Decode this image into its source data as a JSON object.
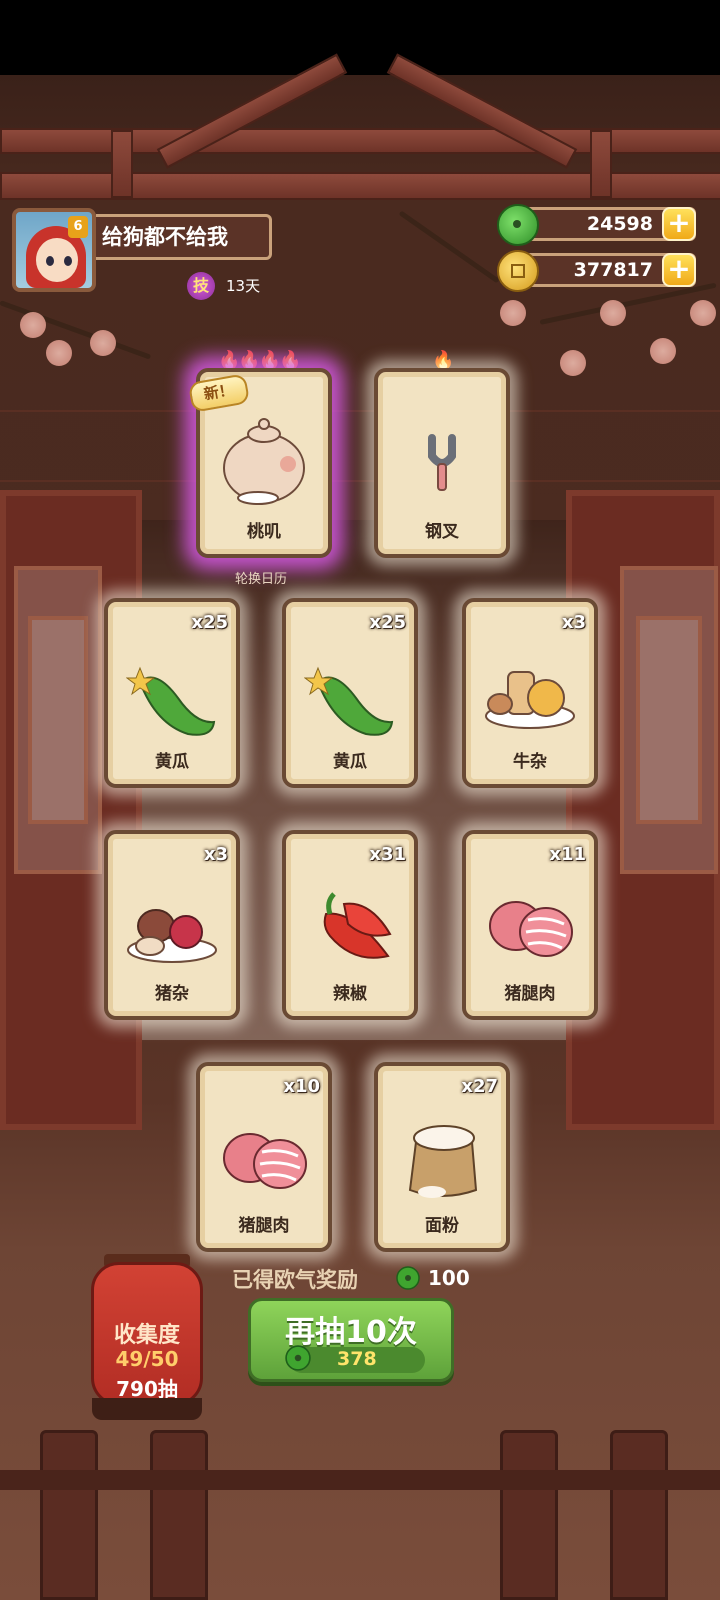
{
  "player": {
    "name": "给狗都不给我",
    "avatar_badge": "6",
    "skill_icon_char": "技",
    "skill_days": "13天"
  },
  "currency": {
    "jade": "24598",
    "coins": "377817",
    "plus": "+"
  },
  "featured": [
    {
      "name": "桃叽",
      "flames": "🔥🔥🔥🔥",
      "new_tag": "新！",
      "rare": true
    },
    {
      "name": "钢叉",
      "flames": "🔥",
      "rare": false
    }
  ],
  "calendar_label": "轮换日历",
  "items": [
    {
      "name": "黄瓜",
      "qty": "x25",
      "art": "cucumber"
    },
    {
      "name": "黄瓜",
      "qty": "x25",
      "art": "cucumber"
    },
    {
      "name": "牛杂",
      "qty": "x3",
      "art": "offal-plate"
    },
    {
      "name": "猪杂",
      "qty": "x3",
      "art": "pork-offal-plate"
    },
    {
      "name": "辣椒",
      "qty": "x31",
      "art": "chili"
    },
    {
      "name": "猪腿肉",
      "qty": "x11",
      "art": "pork-leg"
    },
    {
      "name": "猪腿肉",
      "qty": "x10",
      "art": "pork-leg"
    },
    {
      "name": "面粉",
      "qty": "x27",
      "art": "flour-sack"
    }
  ],
  "reward": {
    "text": "已得欧气奖励",
    "amount": "100"
  },
  "collection": {
    "label": "收集度",
    "progress": "49/50",
    "draws": "790抽"
  },
  "draw_button": {
    "label": "再抽10次",
    "cost": "378"
  },
  "colors": {
    "jade": "#3fa52f",
    "coin": "#e0a21c",
    "rare_glow": "#d75ae6",
    "button_green": "#6fb845"
  }
}
